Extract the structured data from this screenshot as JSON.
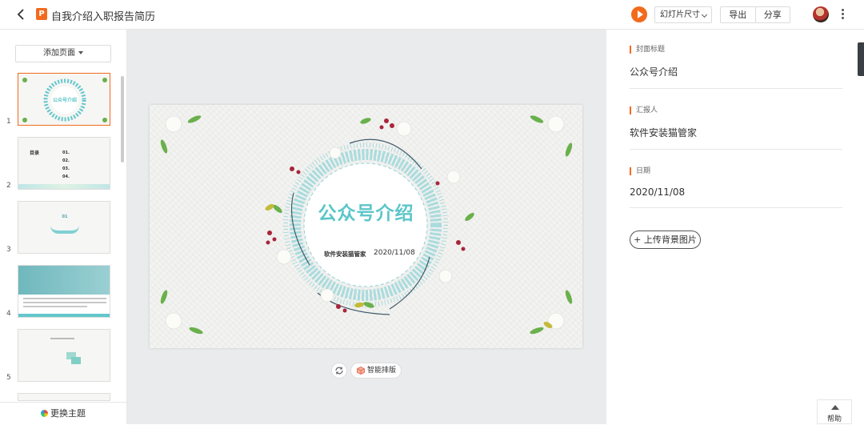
{
  "header": {
    "title": "自我介绍入职报告简历",
    "slide_size_label": "幻灯片尺寸",
    "export_label": "导出",
    "share_label": "分享"
  },
  "sidebar": {
    "add_page_label": "添加页面",
    "change_theme_label": "更换主题",
    "thumbnails": [
      {
        "num": "1",
        "title": "公众号介绍"
      },
      {
        "num": "2",
        "title": "目录",
        "items": [
          "01.",
          "02.",
          "03.",
          "04."
        ]
      },
      {
        "num": "3",
        "title": "01"
      },
      {
        "num": "4",
        "title": ""
      },
      {
        "num": "5",
        "title": ""
      }
    ]
  },
  "slide": {
    "title": "公众号介绍",
    "reporter": "软件安装猫管家",
    "date": "2020/11/08"
  },
  "canvas_tools": {
    "smart_layout_label": "智能排版"
  },
  "properties": {
    "fields": [
      {
        "label": "封面标题",
        "value": "公众号介绍"
      },
      {
        "label": "汇报人",
        "value": "软件安装猫管家"
      },
      {
        "label": "日期",
        "value": "2020/11/08"
      }
    ],
    "upload_bg_label": "上传背景图片"
  },
  "help_label": "帮助",
  "colors": {
    "accent": "#f26b1d",
    "slide_title": "#5cc6c9",
    "wreath": "#63c7cc"
  }
}
